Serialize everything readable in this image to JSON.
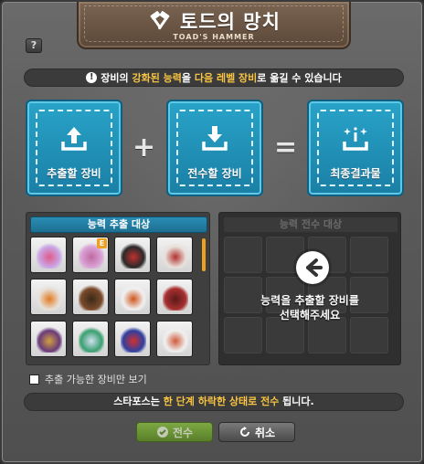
{
  "window": {
    "title": "토드의 망치",
    "subtitle": "TOAD'S HAMMER",
    "help_label": "?"
  },
  "notice": {
    "icon": "warning-icon",
    "before": "장비의 ",
    "hl1": "강화된 능력",
    "mid": "을 ",
    "hl2": "다음 레벨 장비",
    "after": "로 옮길 수 있습니다"
  },
  "slots": {
    "extract_label": "추출할 장비",
    "transfer_label": "전수할 장비",
    "result_label": "최종결과물",
    "plus": "+",
    "equals": "="
  },
  "left_panel": {
    "header": "능력 추출 대상",
    "items": [
      {
        "name": "item-1",
        "color": "#c9a6e6",
        "accent": "#e05a8a",
        "badge": ""
      },
      {
        "name": "item-2",
        "color": "#d9a3d6",
        "accent": "#c06aa0",
        "badge": "E"
      },
      {
        "name": "item-3",
        "color": "#2a2a2a",
        "accent": "#c03030",
        "badge": ""
      },
      {
        "name": "item-4",
        "color": "#e8e0d8",
        "accent": "#b03030",
        "badge": ""
      },
      {
        "name": "item-5",
        "color": "#e8e0d8",
        "accent": "#e07a20",
        "badge": ""
      },
      {
        "name": "item-6",
        "color": "#7a4a2a",
        "accent": "#3a2a1a",
        "badge": ""
      },
      {
        "name": "item-7",
        "color": "#f0f0f0",
        "accent": "#d0541c",
        "badge": ""
      },
      {
        "name": "item-8",
        "color": "#a83030",
        "accent": "#5a1a1a",
        "badge": ""
      },
      {
        "name": "item-9",
        "color": "#6a3a7a",
        "accent": "#d0a040",
        "badge": ""
      },
      {
        "name": "item-10",
        "color": "#3aa070",
        "accent": "#d0e0f0",
        "badge": ""
      },
      {
        "name": "item-11",
        "color": "#3040a0",
        "accent": "#d03030",
        "badge": ""
      },
      {
        "name": "item-12",
        "color": "#f0f0f0",
        "accent": "#d05a3a",
        "badge": ""
      }
    ]
  },
  "right_panel": {
    "header": "능력 전수 대상",
    "message_line1": "능력을 추출할 장비를",
    "message_line2": "선택해주세요"
  },
  "checkbox": {
    "label": "추출 가능한 장비만 보기",
    "checked": false
  },
  "starforce_notice": {
    "before": "스타포스는 ",
    "hl": "한 단계 하락한 상태로 전수",
    "after": " 됩니다."
  },
  "buttons": {
    "transfer_label": "전수",
    "cancel_label": "취소"
  },
  "colors": {
    "accent_blue": "#29a3c9",
    "highlight_yellow": "#f6c343",
    "scroll_orange": "#f0a020"
  }
}
